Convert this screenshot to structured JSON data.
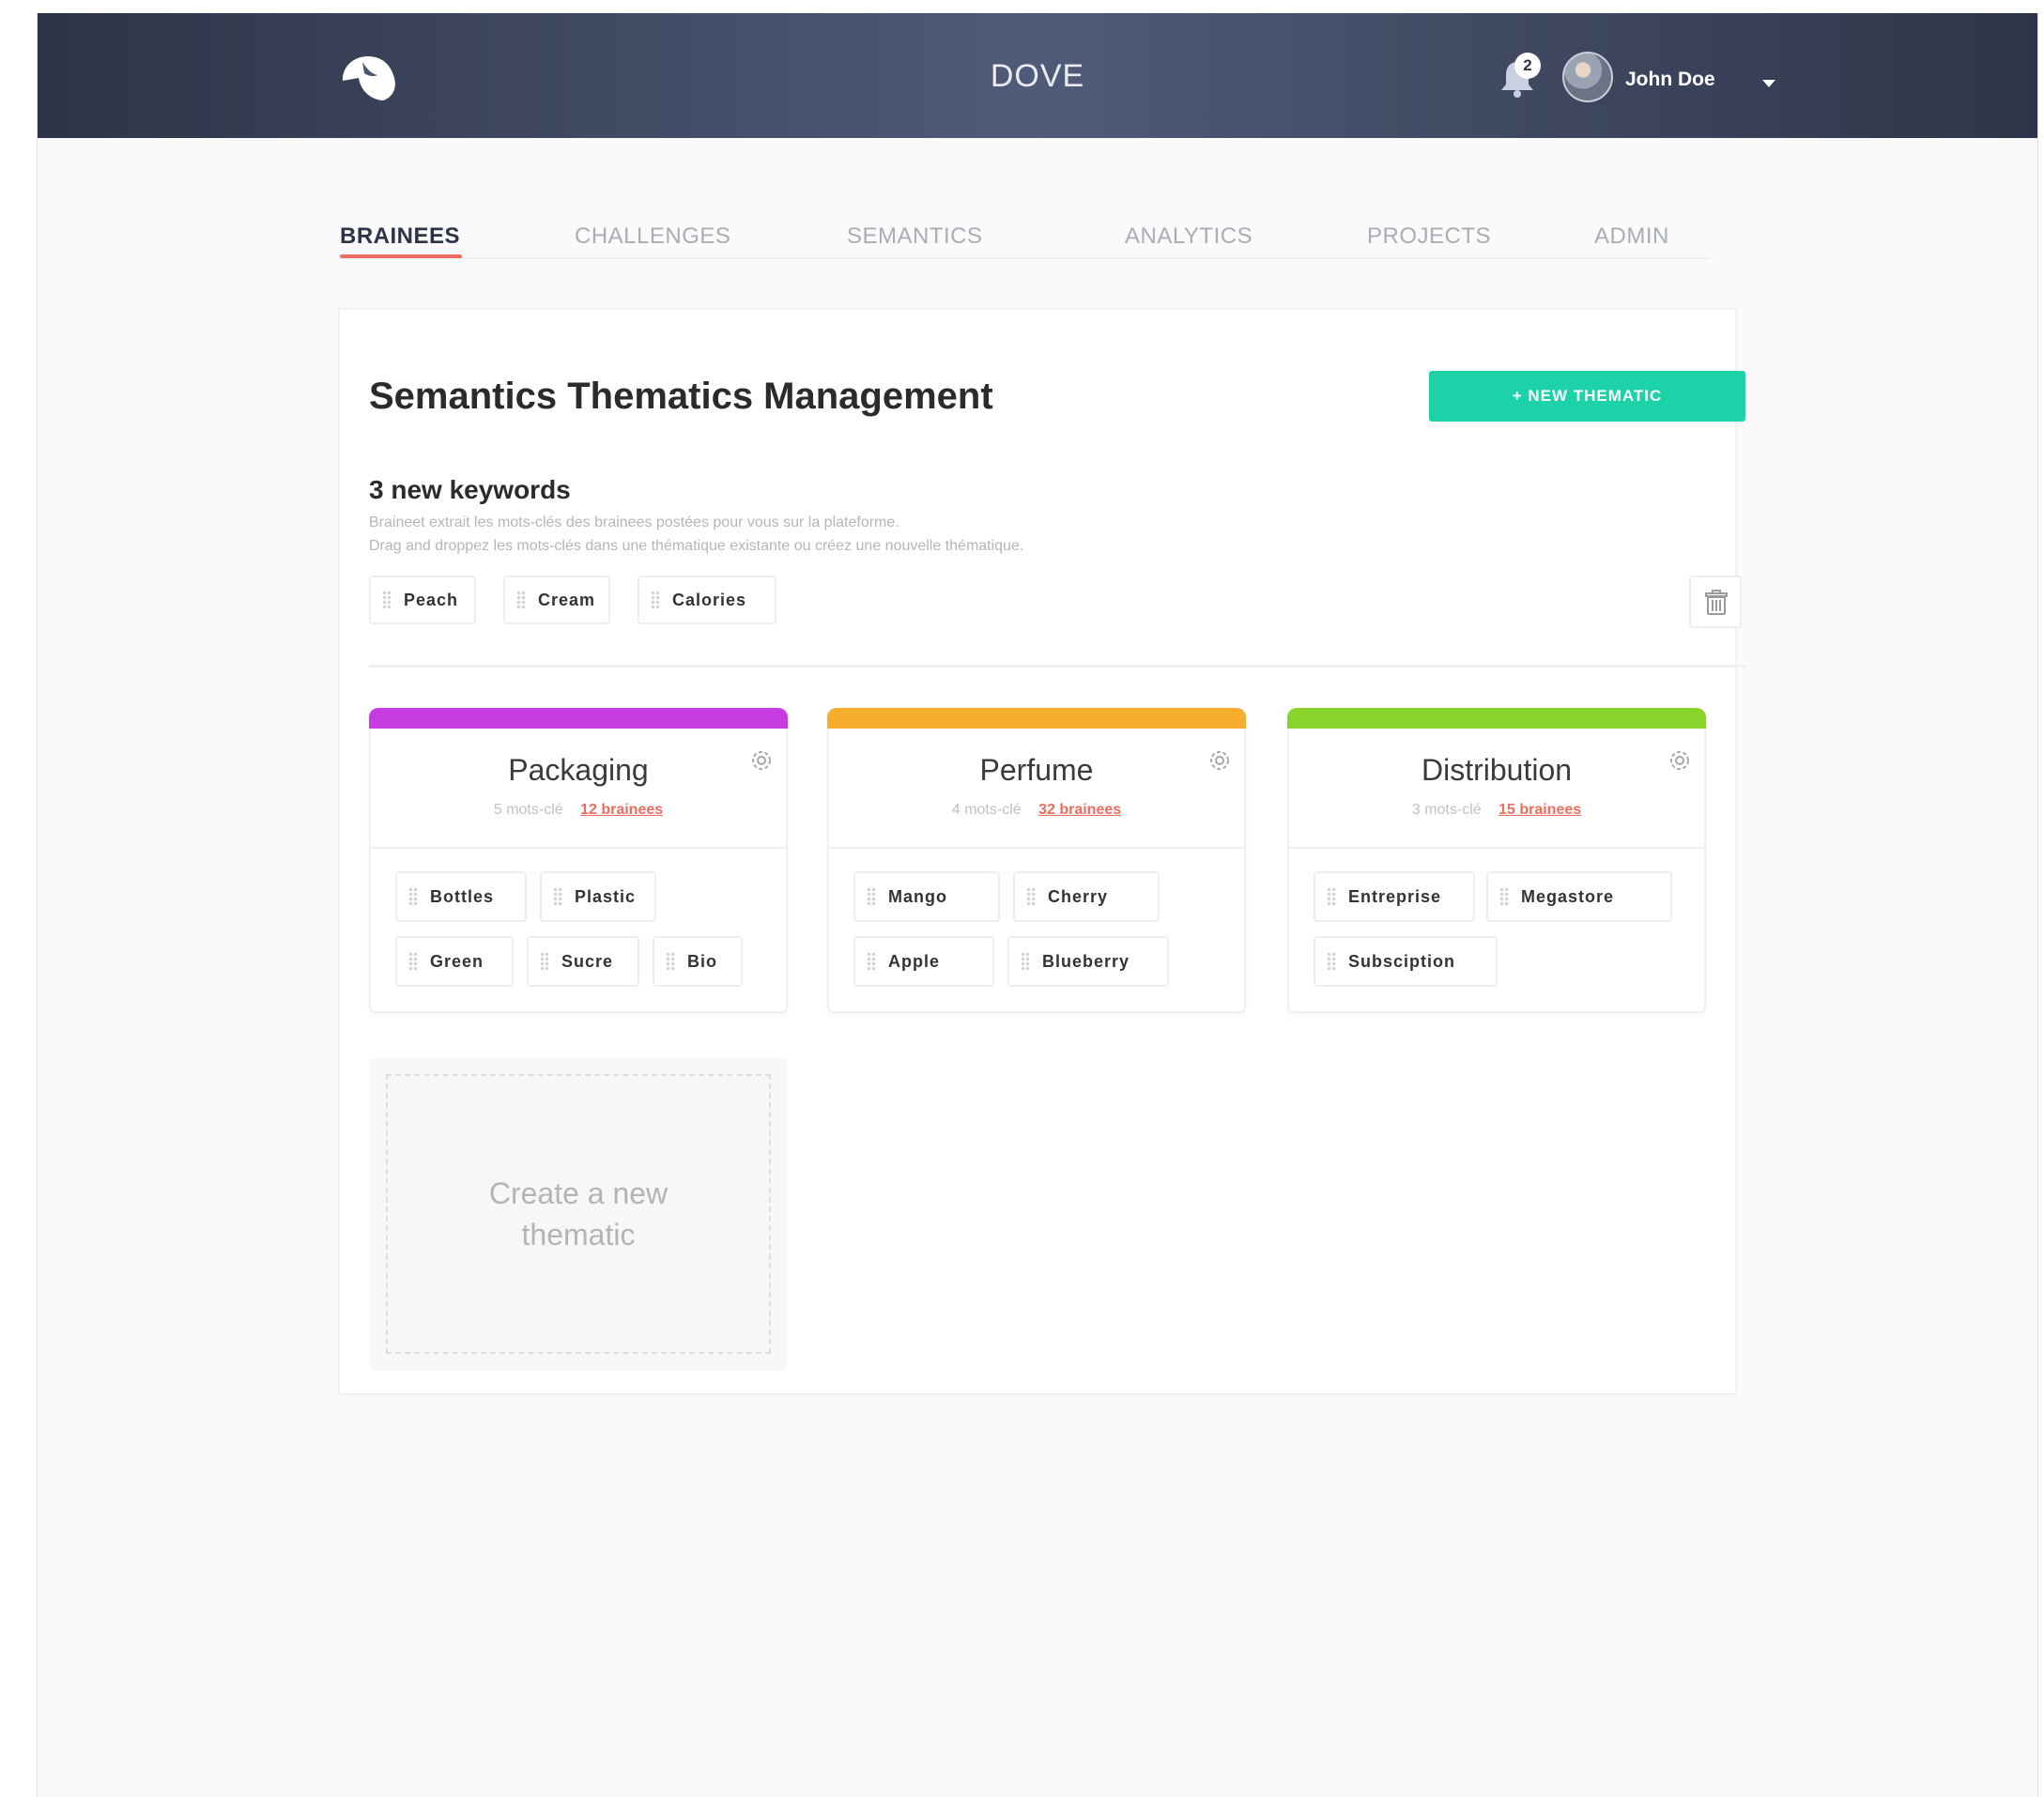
{
  "header": {
    "app_title": "DOVE",
    "notification_count": "2",
    "user_name": "John Doe"
  },
  "tabs": [
    {
      "label": "BRAINEES",
      "active": true
    },
    {
      "label": "CHALLENGES",
      "active": false
    },
    {
      "label": "SEMANTICS",
      "active": false
    },
    {
      "label": "ANALYTICS",
      "active": false
    },
    {
      "label": "PROJECTS",
      "active": false
    },
    {
      "label": "ADMIN",
      "active": false
    }
  ],
  "page": {
    "title": "Semantics Thematics Management",
    "new_button": "+ NEW THEMATIC",
    "keywords_title": "3 new keywords",
    "keywords_desc_1": "Braineet extrait les mots-clés des brainees postées pour vous sur la plateforme.",
    "keywords_desc_2": "Drag and droppez les mots-clés dans une thématique existante ou créez une nouvelle thématique.",
    "new_keywords": [
      "Peach",
      "Cream",
      "Calories"
    ]
  },
  "thematics": [
    {
      "name": "Packaging",
      "mots": "5 mots-clé",
      "brainees": "12 brainees",
      "color": "#c63ce0",
      "keywords": [
        "Bottles",
        "Plastic",
        "Green",
        "Sucre",
        "Bio"
      ]
    },
    {
      "name": "Perfume",
      "mots": "4 mots-clé",
      "brainees": "32 brainees",
      "color": "#f6ac2c",
      "keywords": [
        "Mango",
        "Cherry",
        "Apple",
        "Blueberry"
      ]
    },
    {
      "name": "Distribution",
      "mots": "3 mots-clé",
      "brainees": "15 brainees",
      "color": "#8ad32c",
      "keywords": [
        "Entreprise",
        "Megastore",
        "Subsciption"
      ]
    }
  ],
  "create_card": {
    "label": "Create a new thematic"
  },
  "colors": {
    "accent_green": "#1dd2a8",
    "accent_red": "#ee6d5f",
    "header_dark": "#2d3447"
  },
  "icons": {
    "logo": "dove-logo-icon",
    "notifications": "bell-icon",
    "delete": "trash-icon",
    "settings": "gear-icon"
  }
}
